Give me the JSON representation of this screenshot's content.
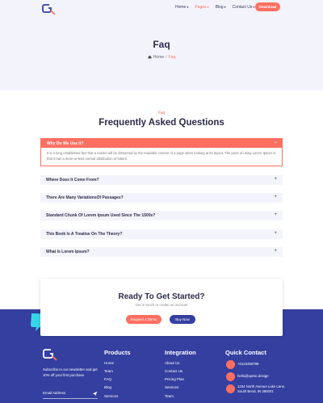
{
  "nav": {
    "items": [
      {
        "label": "Home",
        "active": false
      },
      {
        "label": "Pages",
        "active": true
      },
      {
        "label": "Blog",
        "active": false
      },
      {
        "label": "Contact Us",
        "active": false
      }
    ],
    "download_label": "Download"
  },
  "hero": {
    "title": "Faq",
    "breadcrumb": {
      "home": "Home",
      "separator": "/",
      "current": "Faq"
    }
  },
  "faq": {
    "eyebrow": "Faq",
    "heading": "Frequently Asked Questions",
    "active": {
      "question": "Why Do We Use It?",
      "answer": "It is a long established fact that a reader will be distracted by the readable content of a page when looking at its layout. The point of using Lorem Ipsum is that it has a more-or-less normal distribution of letters."
    },
    "items": [
      "Where Does It Come From?",
      "There Are Many VariationsOf Passages?",
      "Standard Chunk Of Lorem Ipsum Used Since The 1500s?",
      "This Book Is A Treatise On The Theory?",
      "What Is Lorem Ipsum?"
    ],
    "toggle_open": "−",
    "toggle_closed": "+"
  },
  "cta": {
    "title": "Ready To Get Started?",
    "subtitle": "Get in touch or create an account",
    "demo_label": "Request a Demo",
    "buy_label": "Buy Now"
  },
  "footer": {
    "newsletter_text": "Subscribe to our newsletter and get 10% off your first purchase",
    "email_placeholder": "Email Address",
    "products": {
      "title": "Products",
      "links": [
        "Home",
        "Team",
        "FAQ",
        "Blog",
        "Services"
      ]
    },
    "integration": {
      "title": "Integration",
      "links": [
        "About Us",
        "Contact Us",
        "Pricing Plan",
        "Services",
        "Team"
      ]
    },
    "contact": {
      "title": "Quick Contact",
      "phone": "+0123456788",
      "email": "hello@xpmic.design",
      "address": "1234 North Avenue Luke Lane, South Bend, IN 360001"
    }
  },
  "colors": {
    "accent": "#ff6f61",
    "brand": "#343fa0",
    "light_bg": "#f3f4fb"
  },
  "icons": [
    "logo-icon",
    "home-icon",
    "chat-bubble-icon",
    "send-icon",
    "phone-icon",
    "mail-icon",
    "location-icon"
  ]
}
